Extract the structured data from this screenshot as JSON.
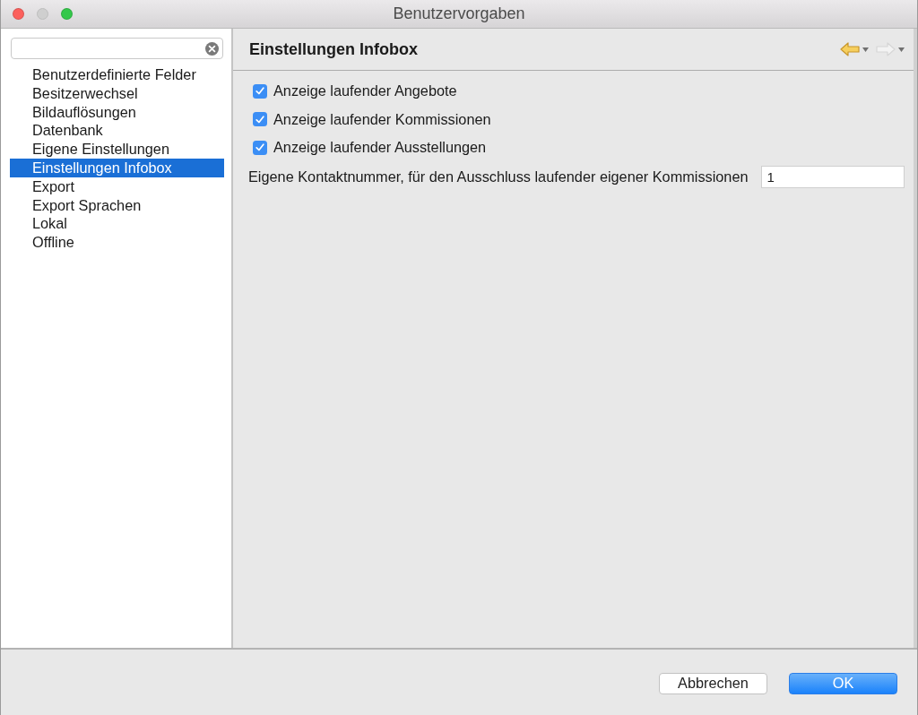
{
  "window": {
    "title": "Benutzervorgaben"
  },
  "window_controls": [
    {
      "kind": "close",
      "disabled": false
    },
    {
      "kind": "minimize",
      "disabled": true
    },
    {
      "kind": "zoom",
      "disabled": false
    }
  ],
  "sidebar": {
    "items": [
      {
        "label": "Benutzerdefinierte Felder",
        "selected": false
      },
      {
        "label": "Besitzerwechsel",
        "selected": false
      },
      {
        "label": "Bildauflösungen",
        "selected": false
      },
      {
        "label": "Datenbank",
        "selected": false
      },
      {
        "label": "Eigene Einstellungen",
        "selected": false
      },
      {
        "label": "Einstellungen Infobox",
        "selected": true
      },
      {
        "label": "Export",
        "selected": false
      },
      {
        "label": "Export Sprachen",
        "selected": false
      },
      {
        "label": "Lokal",
        "selected": false
      },
      {
        "label": "Offline",
        "selected": false
      }
    ]
  },
  "page": {
    "title": "Einstellungen Infobox",
    "nav": [
      {
        "kind": "back",
        "disabled": false
      },
      {
        "kind": "forward",
        "disabled": true
      }
    ]
  },
  "options": [
    {
      "label": "Anzeige laufender Angebote",
      "checked": true
    },
    {
      "label": "Anzeige laufender Kommissionen",
      "checked": true
    },
    {
      "label": "Anzeige laufender Ausstellungen",
      "checked": true
    }
  ],
  "fields": [
    {
      "label": "Eigene Kontaktnummer, für den Ausschluss laufender eigener Kommissionen",
      "value": "1"
    }
  ],
  "buttons": [
    {
      "label": "Abbrechen",
      "kind": "default"
    },
    {
      "label": "OK",
      "kind": "primary"
    }
  ]
}
